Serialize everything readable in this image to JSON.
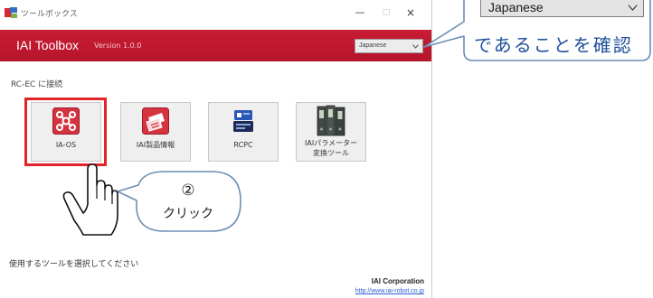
{
  "window": {
    "title": "ツールボックス",
    "minimize_label": "—",
    "maximize_label": "□",
    "close_label": "×",
    "title_icon": "app-icon"
  },
  "header": {
    "app_name": "IAI Toolbox",
    "version": "Version 1.0.0",
    "language_select": "Japanese",
    "language_select_icon": "chevron-down-icon"
  },
  "section_label": "RC-EC に接続",
  "tools": [
    {
      "label": "IA-OS",
      "icon": "network-icon"
    },
    {
      "label": "IAI製品情報",
      "icon": "product-card-icon"
    },
    {
      "label": "RCPC",
      "icon": "controller-icon"
    },
    {
      "label_lines": [
        "IAIパラメーター",
        "変換ツール"
      ],
      "icon": "binders-icon"
    }
  ],
  "footer": {
    "instruction": "使用するツールを選択してください",
    "company": "IAI Corporation",
    "url": "http://www.iai-robot.co.jp"
  },
  "annotations": {
    "step_marker": "②",
    "click_label": "クリック",
    "pointer_icon": "hand-cursor-icon",
    "language_callout": {
      "select_value": "Japanese",
      "text": "であることを確認"
    }
  },
  "colors": {
    "header_red": "#c81c33",
    "highlight_red": "#e3232a",
    "callout_border": "#6d8db5",
    "callout_text": "#1e4f9c",
    "link_blue": "#2f5fd0"
  }
}
